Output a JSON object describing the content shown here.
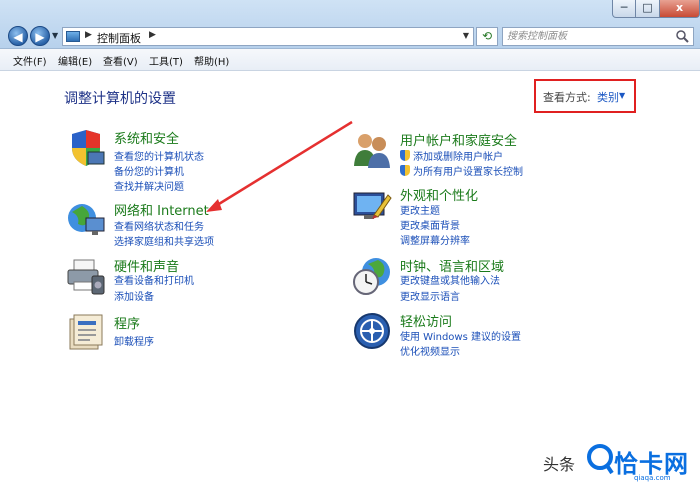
{
  "window": {
    "minimize": "─",
    "maximize": "□",
    "close": "x"
  },
  "address": {
    "crumb": "控制面板",
    "search_placeholder": "搜索控制面板"
  },
  "menu": [
    "文件(F)",
    "编辑(E)",
    "查看(V)",
    "工具(T)",
    "帮助(H)"
  ],
  "page_title": "调整计算机的设置",
  "view_by": {
    "label": "查看方式:",
    "value": "类别"
  },
  "categories_left": [
    {
      "title": "系统和安全",
      "links": [
        "查看您的计算机状态",
        "备份您的计算机",
        "查找并解决问题"
      ],
      "icon": "shield-icon"
    },
    {
      "title": "网络和 Internet",
      "links": [
        "查看网络状态和任务",
        "选择家庭组和共享选项"
      ],
      "icon": "network-globe-icon"
    },
    {
      "title": "硬件和声音",
      "links": [
        "查看设备和打印机",
        "添加设备"
      ],
      "icon": "printer-icon"
    },
    {
      "title": "程序",
      "links": [
        "卸载程序"
      ],
      "icon": "programs-icon"
    }
  ],
  "categories_right": [
    {
      "title": "用户帐户和家庭安全",
      "links": [
        "添加或删除用户帐户",
        "为所有用户设置家长控制"
      ],
      "icon": "users-icon"
    },
    {
      "title": "外观和个性化",
      "links": [
        "更改主题",
        "更改桌面背景",
        "调整屏幕分辨率"
      ],
      "icon": "appearance-icon"
    },
    {
      "title": "时钟、语言和区域",
      "links": [
        "更改键盘或其他输入法",
        "更改显示语言"
      ],
      "icon": "clock-globe-icon"
    },
    {
      "title": "轻松访问",
      "links": [
        "使用 Windows 建议的设置",
        "优化视频显示"
      ],
      "icon": "ease-of-access-icon"
    }
  ],
  "watermark": {
    "text": "头条",
    "brand": "恰卡网",
    "url": "qiaqa.com"
  },
  "colors": {
    "highlight": "#e02020",
    "link": "#1b4fb8",
    "category": "#1a7a1a",
    "title": "#1e3287"
  }
}
